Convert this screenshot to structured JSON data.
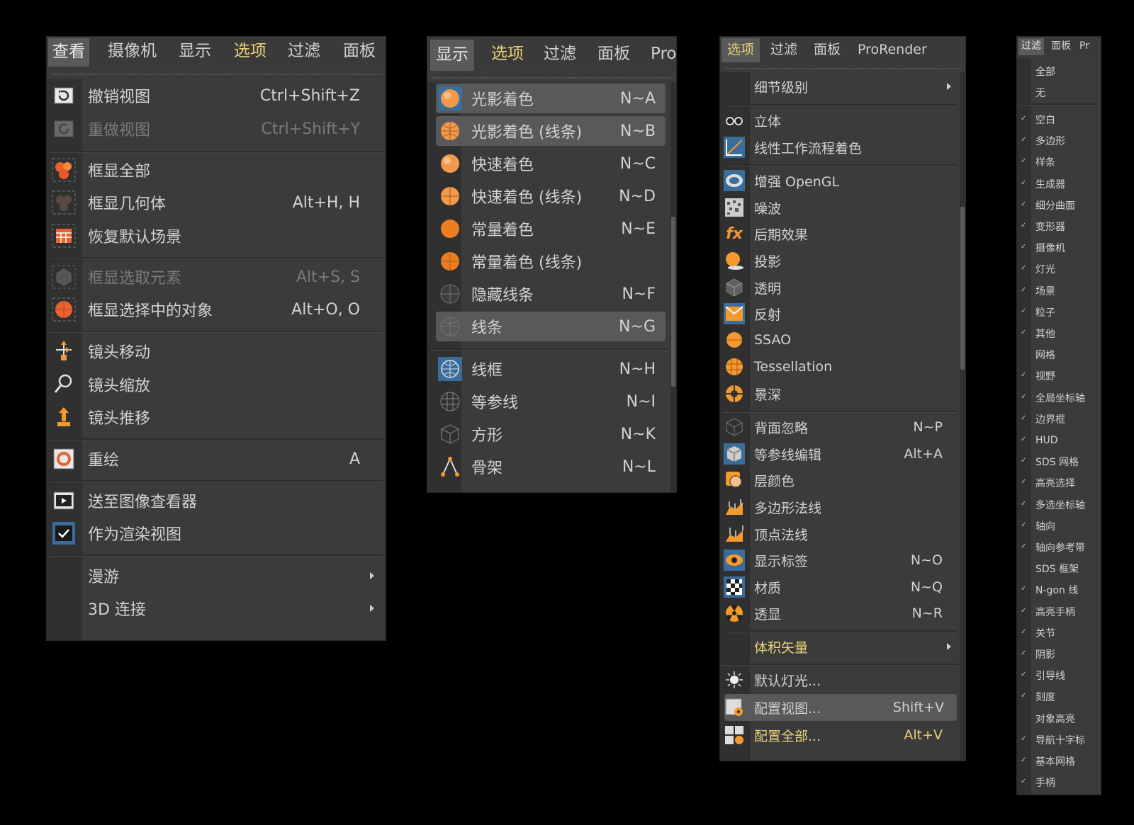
{
  "panel1": {
    "tabs": [
      "查看",
      "摄像机",
      "显示",
      "选项",
      "过滤",
      "面板"
    ],
    "items": [
      {
        "label": "撤销视图",
        "shortcut": "Ctrl+Shift+Z",
        "icon": "undo-view-icon"
      },
      {
        "label": "重做视图",
        "shortcut": "Ctrl+Shift+Y",
        "icon": "redo-view-icon"
      },
      {
        "label": "框显全部",
        "shortcut": "",
        "icon": "frame-all-icon"
      },
      {
        "label": "框显几何体",
        "shortcut": "Alt+H, H",
        "icon": "frame-geometry-icon"
      },
      {
        "label": "恢复默认场景",
        "shortcut": "",
        "icon": "default-scene-icon"
      },
      {
        "label": "框显选取元素",
        "shortcut": "Alt+S, S",
        "icon": "frame-selected-elements-icon"
      },
      {
        "label": "框显选择中的对象",
        "shortcut": "Alt+O, O",
        "icon": "frame-selected-objects-icon"
      },
      {
        "label": "镜头移动",
        "shortcut": "",
        "icon": "camera-move-icon"
      },
      {
        "label": "镜头缩放",
        "shortcut": "",
        "icon": "camera-zoom-icon"
      },
      {
        "label": "镜头推移",
        "shortcut": "",
        "icon": "camera-dolly-icon"
      },
      {
        "label": "重绘",
        "shortcut": "A",
        "icon": "redraw-icon"
      },
      {
        "label": "送至图像查看器",
        "shortcut": "",
        "icon": "picture-viewer-icon"
      },
      {
        "label": "作为渲染视图",
        "shortcut": "",
        "icon": "render-view-icon"
      },
      {
        "label": "漫游",
        "shortcut": "",
        "icon": ""
      },
      {
        "label": "3D 连接",
        "shortcut": "",
        "icon": ""
      }
    ]
  },
  "panel2": {
    "tabs": [
      "显示",
      "选项",
      "过滤",
      "面板",
      "Pro"
    ],
    "items": [
      {
        "label": "光影着色",
        "shortcut": "N~A",
        "icon": "gouraud-shading-icon"
      },
      {
        "label": "光影着色 (线条)",
        "shortcut": "N~B",
        "icon": "gouraud-lines-icon"
      },
      {
        "label": "快速着色",
        "shortcut": "N~C",
        "icon": "quick-shading-icon"
      },
      {
        "label": "快速着色 (线条)",
        "shortcut": "N~D",
        "icon": "quick-lines-icon"
      },
      {
        "label": "常量着色",
        "shortcut": "N~E",
        "icon": "constant-shading-icon"
      },
      {
        "label": "常量着色 (线条)",
        "shortcut": "",
        "icon": "constant-lines-icon"
      },
      {
        "label": "隐藏线条",
        "shortcut": "N~F",
        "icon": "hidden-line-icon"
      },
      {
        "label": "线条",
        "shortcut": "N~G",
        "icon": "lines-icon"
      },
      {
        "label": "线框",
        "shortcut": "N~H",
        "icon": "wireframe-icon"
      },
      {
        "label": "等参线",
        "shortcut": "N~I",
        "icon": "isoparms-icon"
      },
      {
        "label": "方形",
        "shortcut": "N~K",
        "icon": "box-icon"
      },
      {
        "label": "骨架",
        "shortcut": "N~L",
        "icon": "skeleton-icon"
      }
    ]
  },
  "panel3": {
    "tabs": [
      "选项",
      "过滤",
      "面板",
      "ProRender"
    ],
    "items": [
      {
        "label": "细节级别",
        "shortcut": "",
        "icon": ""
      },
      {
        "label": "立体",
        "shortcut": "",
        "icon": "stereo-icon"
      },
      {
        "label": "线性工作流程着色",
        "shortcut": "",
        "icon": "linear-workflow-icon"
      },
      {
        "label": "增强 OpenGL",
        "shortcut": "",
        "icon": "enhanced-opengl-icon"
      },
      {
        "label": "噪波",
        "shortcut": "",
        "icon": "noise-icon"
      },
      {
        "label": "后期效果",
        "shortcut": "",
        "icon": "post-effects-icon"
      },
      {
        "label": "投影",
        "shortcut": "",
        "icon": "shadow-icon"
      },
      {
        "label": "透明",
        "shortcut": "",
        "icon": "transparency-icon"
      },
      {
        "label": "反射",
        "shortcut": "",
        "icon": "reflection-icon"
      },
      {
        "label": "SSAO",
        "shortcut": "",
        "icon": "ssao-icon"
      },
      {
        "label": "Tessellation",
        "shortcut": "",
        "icon": "tessellation-icon"
      },
      {
        "label": "景深",
        "shortcut": "",
        "icon": "depth-of-field-icon"
      },
      {
        "label": "背面忽略",
        "shortcut": "N~P",
        "icon": "backface-culling-icon"
      },
      {
        "label": "等参线编辑",
        "shortcut": "Alt+A",
        "icon": "isoline-editing-icon"
      },
      {
        "label": "层颜色",
        "shortcut": "",
        "icon": "layer-color-icon"
      },
      {
        "label": "多边形法线",
        "shortcut": "",
        "icon": "polygon-normals-icon"
      },
      {
        "label": "顶点法线",
        "shortcut": "",
        "icon": "vertex-normals-icon"
      },
      {
        "label": "显示标签",
        "shortcut": "N~O",
        "icon": "display-tag-icon"
      },
      {
        "label": "材质",
        "shortcut": "N~Q",
        "icon": "textures-icon"
      },
      {
        "label": "透显",
        "shortcut": "N~R",
        "icon": "x-ray-icon"
      },
      {
        "label": "体积矢量",
        "shortcut": "",
        "icon": ""
      },
      {
        "label": "默认灯光...",
        "shortcut": "",
        "icon": "default-light-icon"
      },
      {
        "label": "配置视图...",
        "shortcut": "Shift+V",
        "icon": "configure-view-icon"
      },
      {
        "label": "配置全部...",
        "shortcut": "Alt+V",
        "icon": "configure-all-icon"
      }
    ]
  },
  "panel4": {
    "tabs": [
      "过滤",
      "面板",
      "Pr"
    ],
    "items": [
      {
        "label": "全部",
        "checked": false
      },
      {
        "label": "无",
        "checked": false
      },
      {
        "label": "空白",
        "checked": true
      },
      {
        "label": "多边形",
        "checked": true
      },
      {
        "label": "样条",
        "checked": true
      },
      {
        "label": "生成器",
        "checked": true
      },
      {
        "label": "细分曲面",
        "checked": true
      },
      {
        "label": "变形器",
        "checked": true
      },
      {
        "label": "摄像机",
        "checked": true
      },
      {
        "label": "灯光",
        "checked": true
      },
      {
        "label": "场景",
        "checked": true
      },
      {
        "label": "粒子",
        "checked": true
      },
      {
        "label": "其他",
        "checked": true
      },
      {
        "label": "网格",
        "checked": false
      },
      {
        "label": "视野",
        "checked": true
      },
      {
        "label": "全局坐标轴",
        "checked": true
      },
      {
        "label": "边界框",
        "checked": true
      },
      {
        "label": "HUD",
        "checked": true
      },
      {
        "label": "SDS 网格",
        "checked": true
      },
      {
        "label": "高亮选择",
        "checked": true
      },
      {
        "label": "多选坐标轴",
        "checked": true
      },
      {
        "label": "轴向",
        "checked": true
      },
      {
        "label": "轴向参考带",
        "checked": true
      },
      {
        "label": "SDS 框架",
        "checked": false
      },
      {
        "label": "N-gon 线",
        "checked": true
      },
      {
        "label": "高亮手柄",
        "checked": true
      },
      {
        "label": "关节",
        "checked": true
      },
      {
        "label": "阴影",
        "checked": true
      },
      {
        "label": "引导线",
        "checked": true
      },
      {
        "label": "刻度",
        "checked": true
      },
      {
        "label": "对象高亮",
        "checked": false
      },
      {
        "label": "导航十字标",
        "checked": true
      },
      {
        "label": "基本网格",
        "checked": true
      },
      {
        "label": "手柄",
        "checked": true
      }
    ]
  }
}
